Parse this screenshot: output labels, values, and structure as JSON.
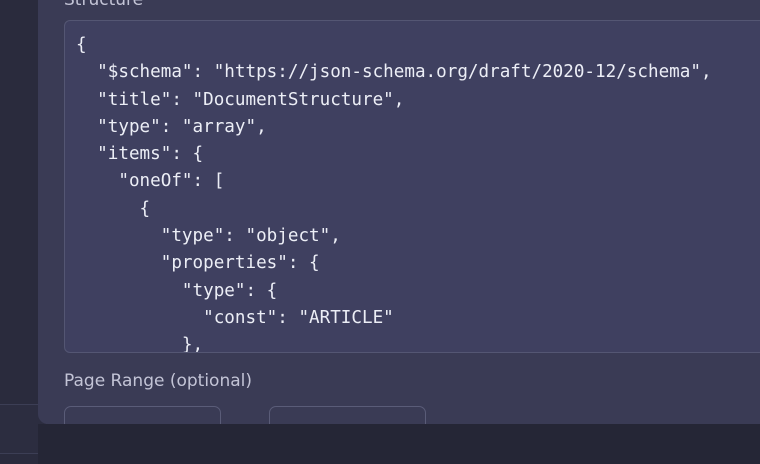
{
  "structure_section": {
    "label": "Structure",
    "schema_code": "{\n  \"$schema\": \"https://json-schema.org/draft/2020-12/schema\",\n  \"title\": \"DocumentStructure\",\n  \"type\": \"array\",\n  \"items\": {\n    \"oneOf\": [\n      {\n        \"type\": \"object\",\n        \"properties\": {\n          \"type\": {\n            \"const\": \"ARTICLE\"\n          },"
  },
  "page_range": {
    "label": "Page Range (optional)",
    "start_value": "",
    "end_value": ""
  }
}
